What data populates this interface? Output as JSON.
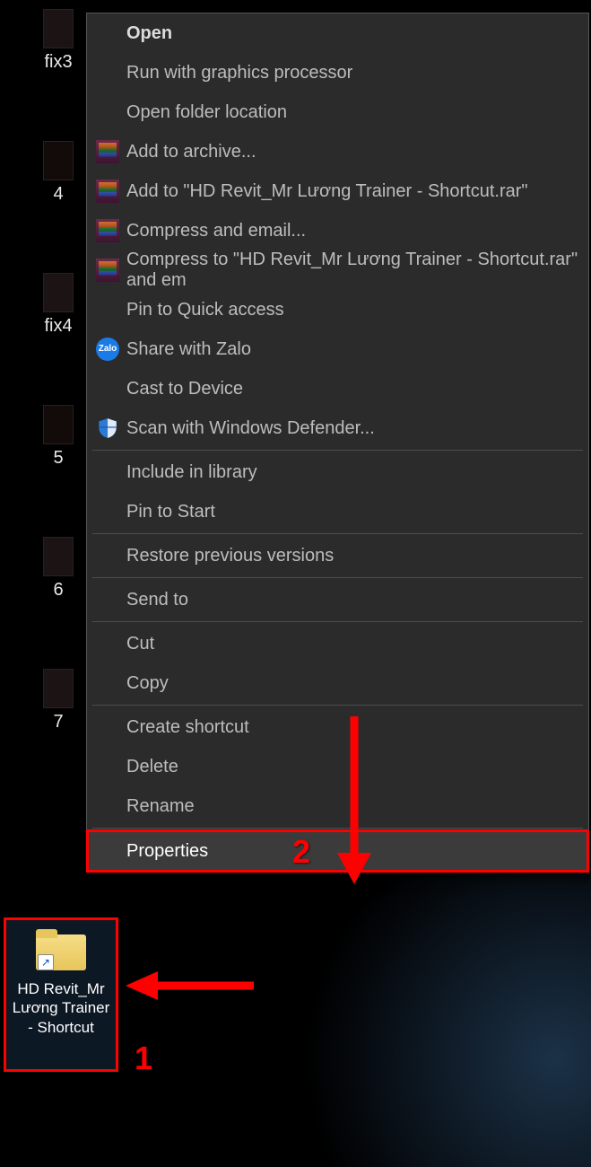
{
  "desktop_icons": [
    {
      "label": "fix3"
    },
    {
      "label": "4"
    },
    {
      "label": "fix4"
    },
    {
      "label": "5"
    },
    {
      "label": "6"
    },
    {
      "label": "7"
    }
  ],
  "selected_shortcut": {
    "label": "HD Revit_Mr Lương Trainer - Shortcut"
  },
  "context_menu": {
    "open": "Open",
    "run_gpu": "Run with graphics processor",
    "open_loc": "Open folder location",
    "add_archive": "Add to archive...",
    "add_named": "Add to \"HD Revit_Mr Lương Trainer - Shortcut.rar\"",
    "compress_email": "Compress and email...",
    "compress_named": "Compress to \"HD Revit_Mr Lương Trainer - Shortcut.rar\" and em",
    "pin_quick": "Pin to Quick access",
    "share_zalo": "Share with Zalo",
    "cast": "Cast to Device",
    "defender": "Scan with Windows Defender...",
    "include_lib": "Include in library",
    "pin_start": "Pin to Start",
    "restore": "Restore previous versions",
    "send_to": "Send to",
    "cut": "Cut",
    "copy": "Copy",
    "create_shortcut": "Create shortcut",
    "delete": "Delete",
    "rename": "Rename",
    "properties": "Properties"
  },
  "annotations": {
    "step1": "1",
    "step2": "2"
  }
}
